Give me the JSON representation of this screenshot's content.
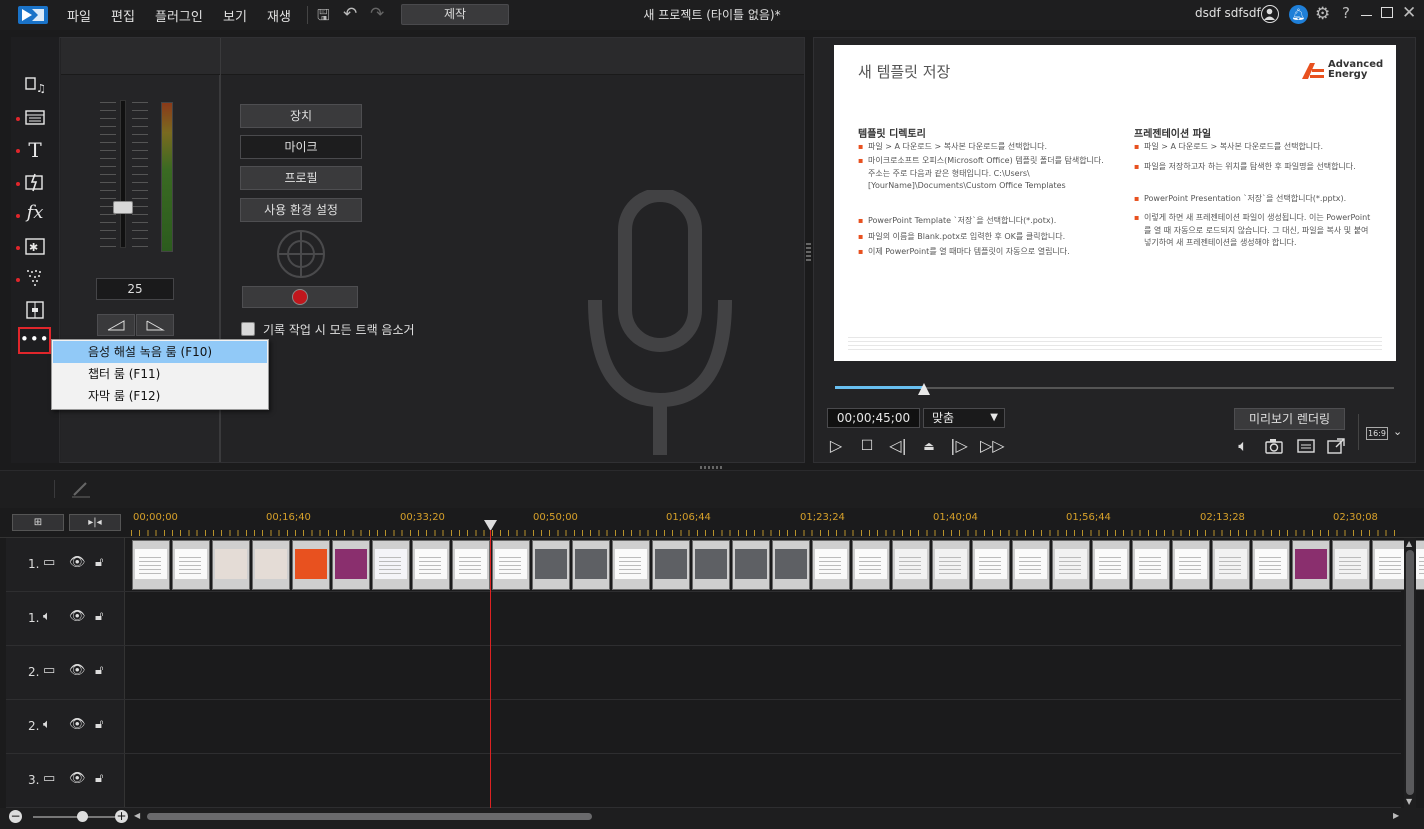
{
  "menu": [
    "파일",
    "편집",
    "플러그인",
    "보기",
    "재생"
  ],
  "produce_label": "제작",
  "window_title": "새 프로젝트 (타이틀 없음)*",
  "user_name": "dsdf sdfsdf",
  "mixer": {
    "volume": "25"
  },
  "recording": {
    "device_label": "장치",
    "mic_value": "마이크",
    "profile_label": "프로필",
    "preferences_label": "사용 환경 설정",
    "mute_label": "기록 작업 시 모든 트랙 음소거"
  },
  "popup_menu": [
    "음성 해설 녹음 룸 (F10)",
    "챕터 룸 (F11)",
    "자막 룸 (F12)"
  ],
  "slide": {
    "title": "새 템플릿 저장",
    "logo_line1": "Advanced",
    "logo_line2": "Energy",
    "left_heading": "템플릿 디렉토리",
    "left_bullets": [
      "파일 > A 다운로드 > 복사본 다운로드를 선택합니다.",
      "마이크로소프트 오피스(Microsoft Office) 템플릿 폴더를 탐색합니다. 주소는 주로 다음과 같은 형태입니다. C:\\Users\\[YourName]\\Documents\\Custom Office Templates",
      "PowerPoint Template `저장`을 선택합니다(*.potx).",
      "파일의 이름을 Blank.potx로 입력한 후 OK를 클릭합니다.",
      "이제 PowerPoint를 열 때마다 템플릿이 자동으로 열립니다."
    ],
    "right_heading": "프레젠테이션 파일",
    "right_bullets": [
      "파일 > A 다운로드 > 복사본 다운로드를 선택합니다.",
      "파일을 저장하고자 하는 위치를 탐색한 후 파일명을 선택합니다.",
      "PowerPoint Presentation `저장`을 선택합니다(*.pptx).",
      "이렇게 하면 새 프레젠테이션 파일이 생성됩니다. 이는 PowerPoint를 열 때 자동으로 로드되지 않습니다. 그 대신, 파일을 복사 및 붙여넣기하여 새 프레젠테이션을 생성해야 합니다."
    ]
  },
  "player": {
    "timecode": "00;00;45;00",
    "fit_label": "맞춤",
    "render_label": "미리보기 렌더링",
    "aspect": "16:9",
    "progress": 0.16
  },
  "ruler": [
    "00;00;00",
    "00;16;40",
    "00;33;20",
    "00;50;00",
    "01;06;44",
    "01;23;24",
    "01;40;04",
    "01;56;44",
    "02;13;28",
    "02;30;08"
  ],
  "tracks": [
    "1.",
    "1.",
    "2.",
    "2.",
    "3."
  ],
  "colors": {
    "accent_red": "#e0262b",
    "timecode_gold": "#d6a02a",
    "popup_select": "#91c9f7",
    "brand_orange": "#e8511f"
  }
}
